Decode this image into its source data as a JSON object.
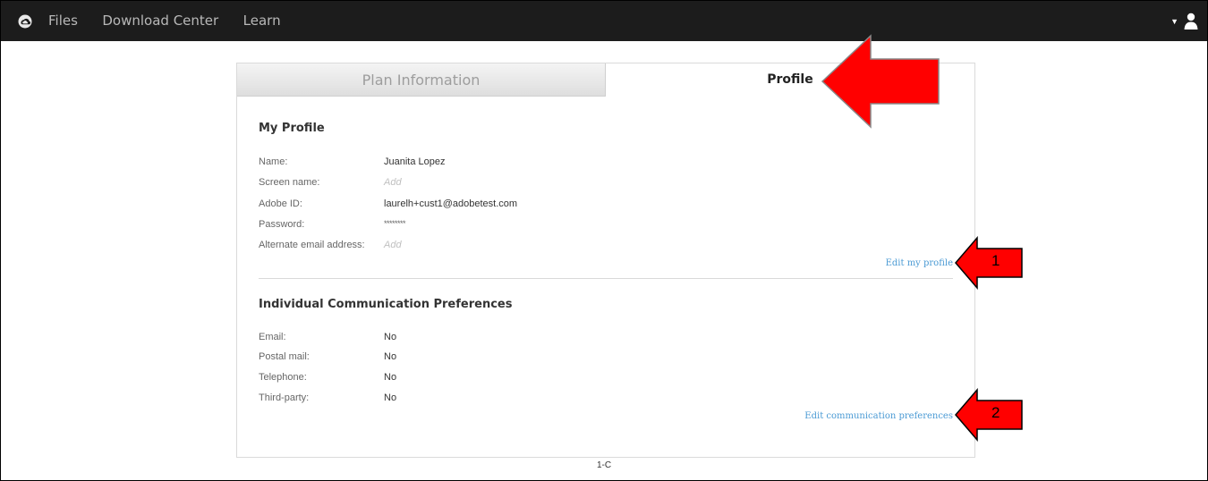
{
  "topbar": {
    "logo_icon": "creative-cloud-icon",
    "nav": [
      "Files",
      "Download Center",
      "Learn"
    ],
    "account_icon": "user-icon",
    "account_caret": "▼"
  },
  "tabs": {
    "plan": "Plan Information",
    "profile": "Profile"
  },
  "my_profile": {
    "title": "My Profile",
    "rows": [
      {
        "label": "Name:",
        "value": "Juanita Lopez"
      },
      {
        "label": "Screen name:",
        "value": "Add"
      },
      {
        "label": "Adobe ID:",
        "value": "laurelh+cust1@adobetest.com"
      },
      {
        "label": "Password:",
        "value": "********"
      },
      {
        "label": "Alternate email address:",
        "value": "Add"
      }
    ],
    "edit_link": "Edit my profile"
  },
  "communication": {
    "title": "Individual Communication Preferences",
    "rows": [
      {
        "label": "Email:",
        "value": "No"
      },
      {
        "label": "Postal mail:",
        "value": "No"
      },
      {
        "label": "Telephone:",
        "value": "No"
      },
      {
        "label": "Third-party:",
        "value": "No"
      }
    ],
    "edit_link": "Edit communication preferences"
  },
  "annotations": {
    "arrow_1_number": "1",
    "arrow_2_number": "2",
    "arrow_color": "#ff0000"
  },
  "footer_label": "1-C"
}
